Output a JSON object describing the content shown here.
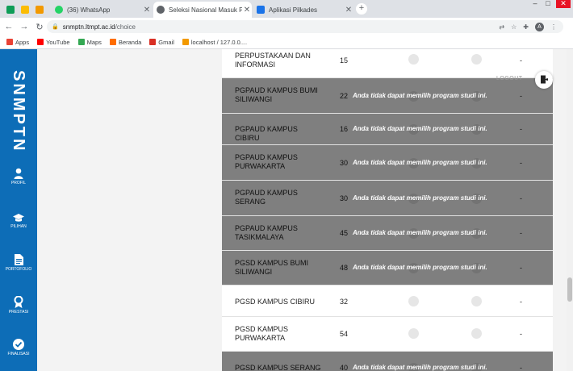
{
  "browser": {
    "tabs": [
      {
        "label": "",
        "fav_color": "#0f9d58",
        "active": false
      },
      {
        "label": "",
        "fav_color": "#fbbc04",
        "active": false
      },
      {
        "label": "",
        "fav_color": "#f29900",
        "active": false
      },
      {
        "label": "(36) WhatsApp",
        "fav_color": "#25d366",
        "active": false
      },
      {
        "label": "Seleksi Nasional Masuk Perguruan",
        "fav_color": "#5f6368",
        "active": true
      },
      {
        "label": "Aplikasi Pilkades",
        "fav_color": "#1a73e8",
        "active": false
      }
    ],
    "url_host": "snmptn.ltmpt.ac.id",
    "url_path": "/choice",
    "profile_initial": "A",
    "bookmarks": [
      {
        "label": "Apps",
        "color": "#e94235"
      },
      {
        "label": "YouTube",
        "color": "#ff0000"
      },
      {
        "label": "Maps",
        "color": "#34a853"
      },
      {
        "label": "Beranda",
        "color": "#ff6d00"
      },
      {
        "label": "Gmail",
        "color": "#d93025"
      },
      {
        "label": "localhost / 127.0.0....",
        "color": "#f29900"
      }
    ]
  },
  "sidebar": {
    "brand": "SNMPTN",
    "items": [
      {
        "label": "PROFIL",
        "icon": "user-icon"
      },
      {
        "label": "PILIHAN",
        "icon": "graduation-cap-icon"
      },
      {
        "label": "PORTOFOLIO",
        "icon": "document-icon"
      },
      {
        "label": "PRESTASI",
        "icon": "award-icon"
      },
      {
        "label": "FINALISASI",
        "icon": "check-circle-icon"
      }
    ]
  },
  "header": {
    "logout_label": "LOGOUT"
  },
  "table": {
    "blocked_message": "Anda tidak dapat memilih program studi ini.",
    "rows": [
      {
        "program": "PERPUSTAKAAN DAN INFORMASI",
        "capacity": "15",
        "blocked": false,
        "dash": "-"
      },
      {
        "program": "PGPAUD KAMPUS BUMI SILIWANGI",
        "capacity": "22",
        "blocked": true,
        "dash": "-"
      },
      {
        "program": "PGPAUD KAMPUS CIBIRU",
        "capacity": "16",
        "blocked": true,
        "dash": "-"
      },
      {
        "program": "PGPAUD KAMPUS PURWAKARTA",
        "capacity": "30",
        "blocked": true,
        "dash": "-"
      },
      {
        "program": "PGPAUD KAMPUS SERANG",
        "capacity": "30",
        "blocked": true,
        "dash": "-"
      },
      {
        "program": "PGPAUD KAMPUS TASIKMALAYA",
        "capacity": "45",
        "blocked": true,
        "dash": "-"
      },
      {
        "program": "PGSD KAMPUS BUMI SILIWANGI",
        "capacity": "48",
        "blocked": true,
        "dash": "-"
      },
      {
        "program": "PGSD KAMPUS CIBIRU",
        "capacity": "32",
        "blocked": false,
        "dash": "-"
      },
      {
        "program": "PGSD KAMPUS PURWAKARTA",
        "capacity": "54",
        "blocked": false,
        "dash": "-"
      },
      {
        "program": "PGSD KAMPUS SERANG",
        "capacity": "40",
        "blocked": true,
        "dash": "-"
      }
    ]
  }
}
